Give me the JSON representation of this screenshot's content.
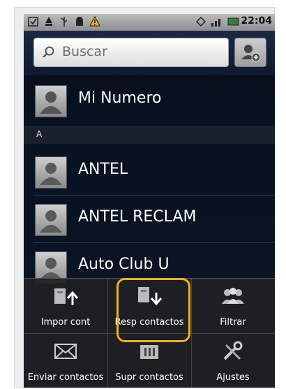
{
  "status_bar": {
    "time": "22:04",
    "icons": [
      "checkbox-icon",
      "usb-debug-icon",
      "usb-icon",
      "android-icon",
      "warning-icon",
      "sync-icon",
      "signal-icon",
      "battery-icon"
    ]
  },
  "search": {
    "placeholder": "Buscar"
  },
  "profile": {
    "label": "Mi Numero"
  },
  "section_header": "A",
  "contacts": [
    {
      "name": "ANTEL"
    },
    {
      "name": "ANTEL RECLAM"
    },
    {
      "name": "Auto Club U"
    }
  ],
  "menu": {
    "items": [
      {
        "label": "Impor cont",
        "icon": "import-icon"
      },
      {
        "label": "Resp contactos",
        "icon": "backup-icon"
      },
      {
        "label": "Filtrar",
        "icon": "filter-icon"
      },
      {
        "label": "Enviar contactos",
        "icon": "send-icon"
      },
      {
        "label": "Supr contactos",
        "icon": "delete-icon"
      },
      {
        "label": "Ajustes",
        "icon": "settings-icon"
      }
    ]
  },
  "colors": {
    "highlight": "#f2b01e",
    "status_bar": "#9a9a9a",
    "list_bg": "#0a1222"
  }
}
